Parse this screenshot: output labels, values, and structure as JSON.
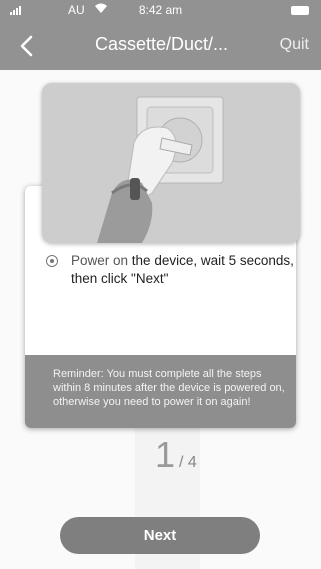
{
  "statusbar": {
    "carrier": "AU",
    "time": "8:42 am"
  },
  "navbar": {
    "title": "Cassette/Duct/...",
    "quit_label": "Quit"
  },
  "step": {
    "instruction_highlight": "Power on",
    "instruction_rest": " the device, wait 5 seconds, then click \"Next\"",
    "reminder": "Reminder: You must complete all the steps within 8 minutes after the device is powered on, otherwise you need  to power it on again!",
    "current": "1",
    "total": "/ 4"
  },
  "footer": {
    "next_label": "Next"
  }
}
